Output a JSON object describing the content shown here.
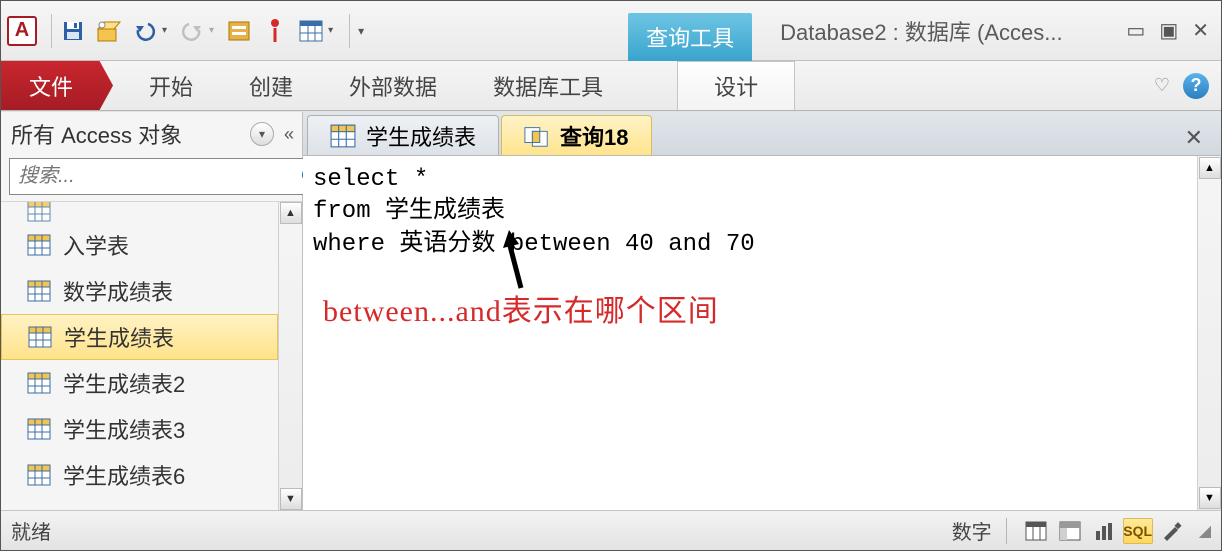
{
  "app": {
    "logo_letter": "A"
  },
  "titlebar": {
    "context_tab": "查询工具",
    "window_title": "Database2 : 数据库 (Acces...",
    "min": "▭",
    "restore": "▣",
    "close": "✕"
  },
  "ribbon": {
    "file": "文件",
    "tabs": [
      "开始",
      "创建",
      "外部数据",
      "数据库工具"
    ],
    "context_tab": "设计"
  },
  "sidebar": {
    "title": "所有 Access 对象",
    "collapse": "«",
    "search_placeholder": "搜索...",
    "items": [
      {
        "label": "入学表"
      },
      {
        "label": "数学成绩表"
      },
      {
        "label": "学生成绩表",
        "selected": true
      },
      {
        "label": "学生成绩表2"
      },
      {
        "label": "学生成绩表3"
      },
      {
        "label": "学生成绩表6"
      }
    ]
  },
  "doc_tabs": {
    "items": [
      {
        "label": "学生成绩表",
        "type": "table",
        "active": false
      },
      {
        "label": "查询18",
        "type": "query",
        "active": true
      }
    ],
    "close": "✕"
  },
  "sql": {
    "text": "select *\nfrom 学生成绩表\nwhere 英语分数 between 40 and 70"
  },
  "annotation": {
    "text": "between...and表示在哪个区间"
  },
  "statusbar": {
    "left": "就绪",
    "right_text": "数字",
    "active_view_label": "SQL"
  }
}
